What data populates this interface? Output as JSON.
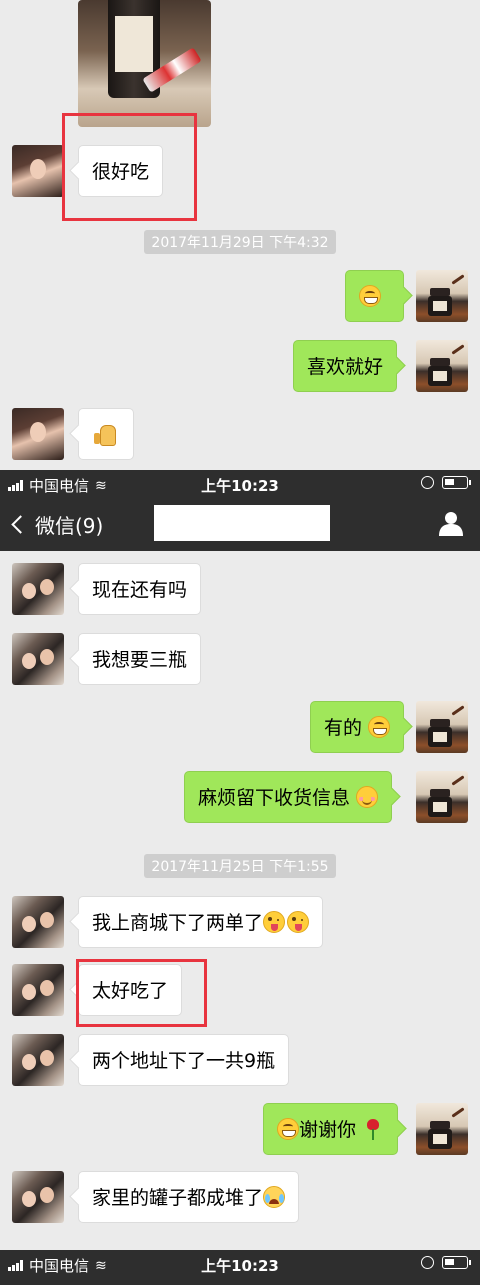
{
  "status_bar": {
    "carrier": "中国电信",
    "time": "上午10:23"
  },
  "nav": {
    "back_label": "微信(9)"
  },
  "section1": {
    "msg_good": "很好吃",
    "timestamp": "2017年11月29日 下午4:32",
    "msg_like": "喜欢就好"
  },
  "section2": {
    "msg1": "现在还有吗",
    "msg2": "我想要三瓶",
    "msg3": "有的",
    "msg4": "麻烦留下收货信息",
    "timestamp": "2017年11月25日 下午1:55",
    "msg5": "我上商城下了两单了",
    "msg6": "太好吃了",
    "msg7": "两个地址下了一共9瓶",
    "msg8": "谢谢你",
    "msg9": "家里的罐子都成堆了"
  },
  "icons": {
    "grin": "grin-emoji-icon",
    "blush": "blush-emoji-icon",
    "tongue": "tongue-emoji-icon",
    "cry": "laugh-cry-emoji-icon",
    "rose": "rose-emoji-icon",
    "thumbs_up": "thumbs-up-icon"
  },
  "colors": {
    "bubble_out": "#a0e75a",
    "bubble_in": "#ffffff",
    "bar": "#2e2e2e",
    "highlight": "#e8343f"
  }
}
